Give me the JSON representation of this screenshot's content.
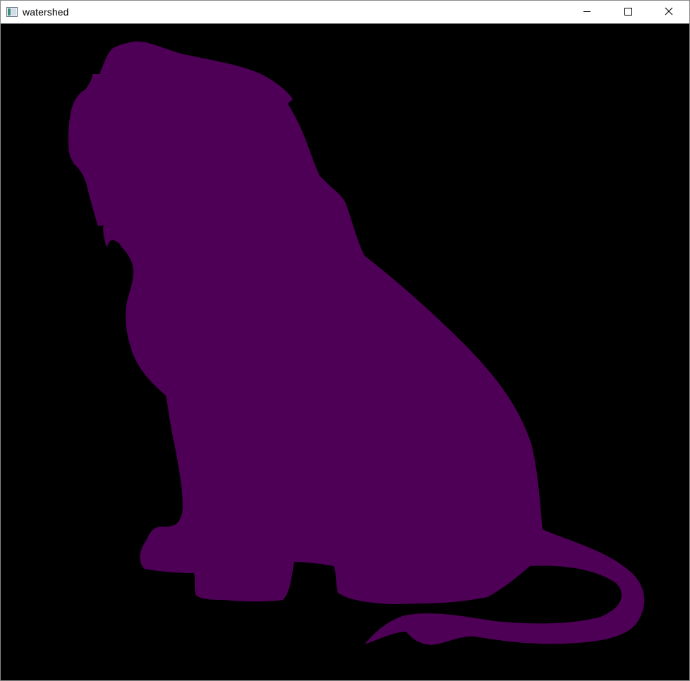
{
  "window": {
    "title": "watershed",
    "icon": "app-window-icon",
    "controls": {
      "minimize": "minimize-icon",
      "maximize": "maximize-icon",
      "close": "close-icon"
    }
  },
  "canvas": {
    "background_color": "#000000",
    "segment_color": "#4e0056",
    "subject": "lion silhouette"
  }
}
